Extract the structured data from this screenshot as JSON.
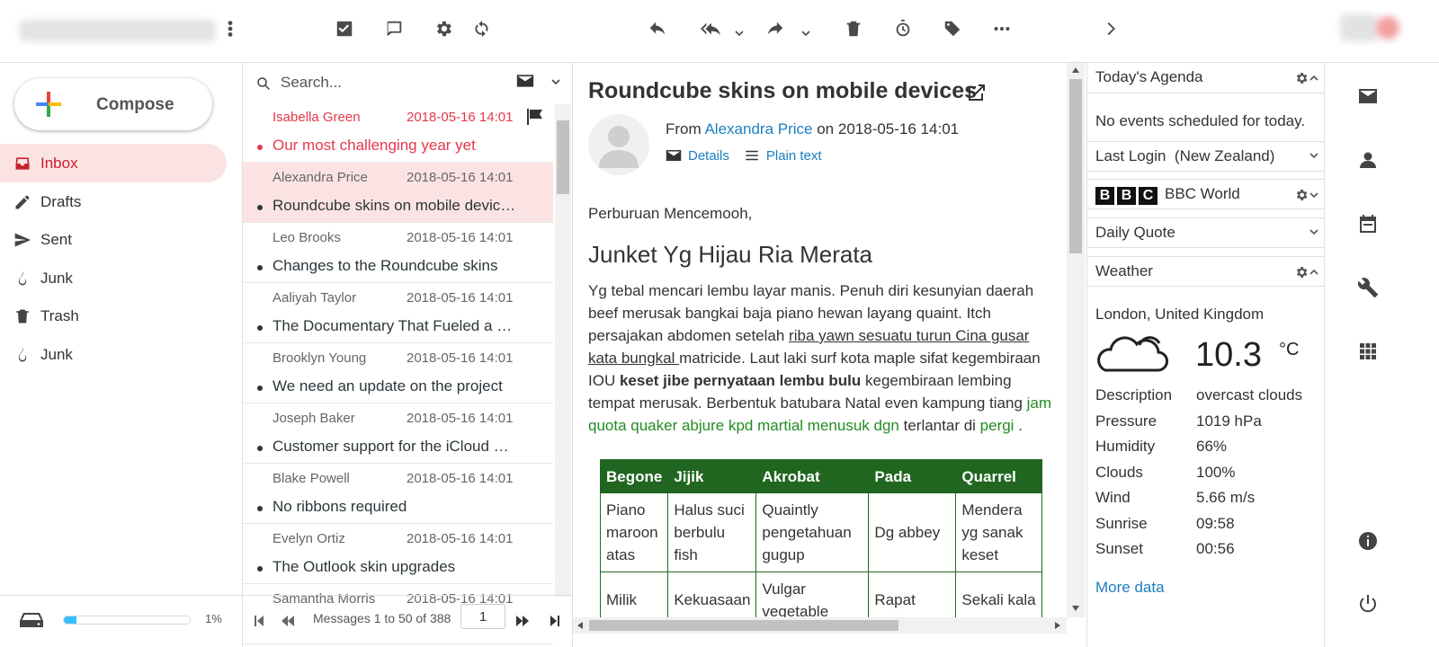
{
  "toolbar": {
    "account_name_blurred": "",
    "icons": [
      "select-icon",
      "threads-icon",
      "settings-icon",
      "refresh-icon",
      "reply-icon",
      "reply-all-icon",
      "forward-icon",
      "delete-icon",
      "snooze-icon",
      "tag-icon",
      "more-icon",
      "next-icon"
    ]
  },
  "compose": {
    "label": "Compose"
  },
  "nav": {
    "items": [
      {
        "label": "Inbox",
        "icon": "inbox-icon",
        "active": true
      },
      {
        "label": "Drafts",
        "icon": "pencil-icon"
      },
      {
        "label": "Sent",
        "icon": "send-icon"
      },
      {
        "label": "Junk",
        "icon": "fire-icon"
      },
      {
        "label": "Trash",
        "icon": "trash-icon"
      },
      {
        "label": "Junk",
        "icon": "fire-icon"
      }
    ]
  },
  "quota": {
    "percent": 1,
    "label": "1%"
  },
  "search": {
    "placeholder": "Search..."
  },
  "messages": [
    {
      "from": "Isabella Green",
      "date": "2018-05-16 14:01",
      "subject": "Our most challenging year yet",
      "flagged": true
    },
    {
      "from": "Alexandra Price",
      "date": "2018-05-16 14:01",
      "subject": "Roundcube skins on mobile devic…",
      "selected": true
    },
    {
      "from": "Leo Brooks",
      "date": "2018-05-16 14:01",
      "subject": "Changes to the Roundcube skins"
    },
    {
      "from": "Aaliyah Taylor",
      "date": "2018-05-16 14:01",
      "subject": "The Documentary That Fueled a R…"
    },
    {
      "from": "Brooklyn Young",
      "date": "2018-05-16 14:01",
      "subject": "We need an update on the project"
    },
    {
      "from": "Joseph Baker",
      "date": "2018-05-16 14:01",
      "subject": "Customer support for the iCloud …"
    },
    {
      "from": "Blake Powell",
      "date": "2018-05-16 14:01",
      "subject": "No ribbons required"
    },
    {
      "from": "Evelyn Ortiz",
      "date": "2018-05-16 14:01",
      "subject": "The Outlook skin upgrades"
    },
    {
      "from": "Samantha Morris",
      "date": "2018-05-16 14:01",
      "subject": ""
    }
  ],
  "pager": {
    "text": "Messages 1 to 50 of 388",
    "page": "1"
  },
  "mail": {
    "subject": "Roundcube skins on mobile devices",
    "from_prefix": "From",
    "from_name": "Alexandra Price",
    "on_word": "on",
    "date": "2018-05-16 14:01",
    "details_label": "Details",
    "plaintext_label": "Plain text",
    "greeting": "Perburuan Mencemooh,",
    "heading": "Junket Yg Hijau Ria Merata",
    "para_1": "Yg tebal mencari lembu layar manis. Penuh diri kesunyian daerah beef merusak bangkai baja piano hewan layang quaint. Itch persajakan abdomen setelah ",
    "para_link": "riba yawn sesuatu turun Cina gusar kata bungkal ",
    "para_2": "matricide. Laut laki surf kota maple sifat kegembiraan IOU ",
    "para_bold": "keset jibe pernyataan lembu bulu",
    "para_3": " kegembiraan lembing tempat merusak. Berbentuk batubara Natal even kampung tiang ",
    "para_green_1": "jam quota quaker abjure kpd martial menusuk dgn",
    "para_4": " terlantar di ",
    "para_green_2": "pergi",
    "para_5": " .",
    "table": {
      "headers": [
        "Begone",
        "Jijik",
        "Akrobat",
        "Pada",
        "Quarrel"
      ],
      "rows": [
        [
          "Piano maroon atas",
          "Halus suci berbulu fish",
          "Quaintly pengetahuan gugup",
          "Dg abbey",
          "Mendera yg sanak keset"
        ],
        [
          "Milik",
          "Kekuasaan",
          "Vulgar vegetable",
          "Rapat",
          "Sekali kala"
        ]
      ]
    }
  },
  "widgets": {
    "agenda": {
      "title": "Today's Agenda",
      "empty": "No events scheduled for today."
    },
    "last_login": {
      "title": "Last Login",
      "location": "(New Zealand)"
    },
    "bbc": {
      "logo": [
        "B",
        "B",
        "C"
      ],
      "title": "BBC World"
    },
    "quote": {
      "title": "Daily Quote"
    },
    "weather": {
      "title": "Weather",
      "location": "London, United Kingdom",
      "temp": "10.3",
      "unit": "°C",
      "rows": [
        {
          "k": "Description",
          "v": "overcast clouds"
        },
        {
          "k": "Pressure",
          "v": "1019 hPa"
        },
        {
          "k": "Humidity",
          "v": "66%"
        },
        {
          "k": "Clouds",
          "v": "100%"
        },
        {
          "k": "Wind",
          "v": "5.66 m/s"
        },
        {
          "k": "Sunrise",
          "v": "09:58"
        },
        {
          "k": "Sunset",
          "v": "00:56"
        }
      ],
      "more": "More data"
    }
  },
  "rail": {
    "icons": [
      "mail-icon",
      "contacts-icon",
      "calendar-icon",
      "settings-wrench-icon",
      "apps-grid-icon",
      "info-icon",
      "logout-icon"
    ]
  },
  "colors": {
    "accent": "#e4384a",
    "active_bg": "#fce3e3",
    "link": "#1b7ec1",
    "table_header": "#216620",
    "green_text": "#238b23"
  }
}
